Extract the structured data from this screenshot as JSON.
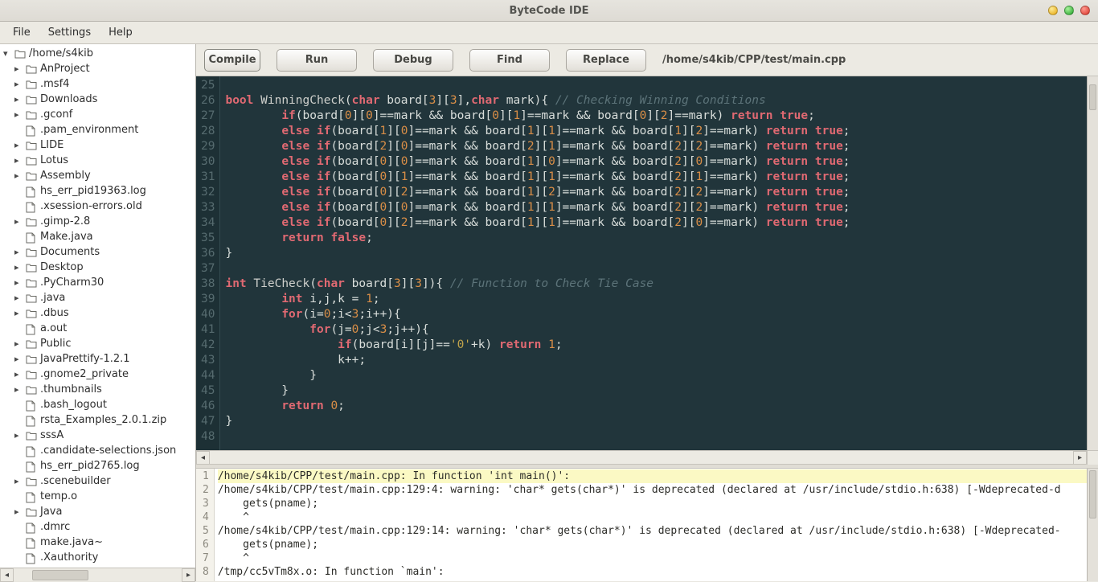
{
  "window": {
    "title": "ByteCode IDE"
  },
  "menu": {
    "file": "File",
    "settings": "Settings",
    "help": "Help"
  },
  "toolbar": {
    "compile": "Compile",
    "run": "Run",
    "debug": "Debug",
    "find": "Find",
    "replace": "Replace",
    "path": "/home/s4kib/CPP/test/main.cpp"
  },
  "tree": {
    "root": "/home/s4kib",
    "items": [
      {
        "type": "folder",
        "name": "AnProject"
      },
      {
        "type": "folder",
        "name": ".msf4"
      },
      {
        "type": "folder",
        "name": "Downloads"
      },
      {
        "type": "folder",
        "name": ".gconf"
      },
      {
        "type": "file",
        "name": ".pam_environment"
      },
      {
        "type": "folder",
        "name": "LIDE"
      },
      {
        "type": "folder",
        "name": "Lotus"
      },
      {
        "type": "folder",
        "name": "Assembly"
      },
      {
        "type": "file",
        "name": "hs_err_pid19363.log"
      },
      {
        "type": "file",
        "name": ".xsession-errors.old"
      },
      {
        "type": "folder",
        "name": ".gimp-2.8"
      },
      {
        "type": "file",
        "name": "Make.java"
      },
      {
        "type": "folder",
        "name": "Documents"
      },
      {
        "type": "folder",
        "name": "Desktop"
      },
      {
        "type": "folder",
        "name": ".PyCharm30"
      },
      {
        "type": "folder",
        "name": ".java"
      },
      {
        "type": "folder",
        "name": ".dbus"
      },
      {
        "type": "file",
        "name": "a.out"
      },
      {
        "type": "folder",
        "name": "Public"
      },
      {
        "type": "folder",
        "name": "JavaPrettify-1.2.1"
      },
      {
        "type": "folder",
        "name": ".gnome2_private"
      },
      {
        "type": "folder",
        "name": ".thumbnails"
      },
      {
        "type": "file",
        "name": ".bash_logout"
      },
      {
        "type": "file",
        "name": "rsta_Examples_2.0.1.zip"
      },
      {
        "type": "folder",
        "name": "sssA"
      },
      {
        "type": "file",
        "name": ".candidate-selections.json"
      },
      {
        "type": "file",
        "name": "hs_err_pid2765.log"
      },
      {
        "type": "folder",
        "name": ".scenebuilder"
      },
      {
        "type": "file",
        "name": "temp.o"
      },
      {
        "type": "folder",
        "name": "Java"
      },
      {
        "type": "file",
        "name": ".dmrc"
      },
      {
        "type": "file",
        "name": "make.java~"
      },
      {
        "type": "file",
        "name": ".Xauthority"
      }
    ]
  },
  "editor": {
    "first_line": 25,
    "lines": [
      {
        "n": 25,
        "seg": [
          [
            "",
            ""
          ]
        ]
      },
      {
        "n": 26,
        "seg": [
          [
            "kw",
            "bool"
          ],
          [
            "",
            " "
          ],
          [
            "fn",
            "WinningCheck"
          ],
          [
            "",
            "("
          ],
          [
            "type",
            "char"
          ],
          [
            "",
            " board["
          ],
          [
            "num",
            "3"
          ],
          [
            "",
            "]["
          ],
          [
            "num",
            "3"
          ],
          [
            "",
            "],"
          ],
          [
            "type",
            "char"
          ],
          [
            "",
            " mark){ "
          ],
          [
            "cmt",
            "// Checking Winning Conditions"
          ]
        ]
      },
      {
        "n": 27,
        "seg": [
          [
            "",
            "        "
          ],
          [
            "kw",
            "if"
          ],
          [
            "",
            "(board["
          ],
          [
            "num",
            "0"
          ],
          [
            "",
            "]["
          ],
          [
            "num",
            "0"
          ],
          [
            "",
            "]==mark && board["
          ],
          [
            "num",
            "0"
          ],
          [
            "",
            "]["
          ],
          [
            "num",
            "1"
          ],
          [
            "",
            "]==mark && board["
          ],
          [
            "num",
            "0"
          ],
          [
            "",
            "]["
          ],
          [
            "num",
            "2"
          ],
          [
            "",
            "]==mark) "
          ],
          [
            "kw",
            "return"
          ],
          [
            "",
            " "
          ],
          [
            "kw",
            "true"
          ],
          [
            "",
            ";"
          ]
        ]
      },
      {
        "n": 28,
        "seg": [
          [
            "",
            "        "
          ],
          [
            "kw",
            "else"
          ],
          [
            "",
            " "
          ],
          [
            "kw",
            "if"
          ],
          [
            "",
            "(board["
          ],
          [
            "num",
            "1"
          ],
          [
            "",
            "]["
          ],
          [
            "num",
            "0"
          ],
          [
            "",
            "]==mark && board["
          ],
          [
            "num",
            "1"
          ],
          [
            "",
            "]["
          ],
          [
            "num",
            "1"
          ],
          [
            "",
            "]==mark && board["
          ],
          [
            "num",
            "1"
          ],
          [
            "",
            "]["
          ],
          [
            "num",
            "2"
          ],
          [
            "",
            "]==mark) "
          ],
          [
            "kw",
            "return"
          ],
          [
            "",
            " "
          ],
          [
            "kw",
            "true"
          ],
          [
            "",
            ";"
          ]
        ]
      },
      {
        "n": 29,
        "seg": [
          [
            "",
            "        "
          ],
          [
            "kw",
            "else"
          ],
          [
            "",
            " "
          ],
          [
            "kw",
            "if"
          ],
          [
            "",
            "(board["
          ],
          [
            "num",
            "2"
          ],
          [
            "",
            "]["
          ],
          [
            "num",
            "0"
          ],
          [
            "",
            "]==mark && board["
          ],
          [
            "num",
            "2"
          ],
          [
            "",
            "]["
          ],
          [
            "num",
            "1"
          ],
          [
            "",
            "]==mark && board["
          ],
          [
            "num",
            "2"
          ],
          [
            "",
            "]["
          ],
          [
            "num",
            "2"
          ],
          [
            "",
            "]==mark) "
          ],
          [
            "kw",
            "return"
          ],
          [
            "",
            " "
          ],
          [
            "kw",
            "true"
          ],
          [
            "",
            ";"
          ]
        ]
      },
      {
        "n": 30,
        "seg": [
          [
            "",
            "        "
          ],
          [
            "kw",
            "else"
          ],
          [
            "",
            " "
          ],
          [
            "kw",
            "if"
          ],
          [
            "",
            "(board["
          ],
          [
            "num",
            "0"
          ],
          [
            "",
            "]["
          ],
          [
            "num",
            "0"
          ],
          [
            "",
            "]==mark && board["
          ],
          [
            "num",
            "1"
          ],
          [
            "",
            "]["
          ],
          [
            "num",
            "0"
          ],
          [
            "",
            "]==mark && board["
          ],
          [
            "num",
            "2"
          ],
          [
            "",
            "]["
          ],
          [
            "num",
            "0"
          ],
          [
            "",
            "]==mark) "
          ],
          [
            "kw",
            "return"
          ],
          [
            "",
            " "
          ],
          [
            "kw",
            "true"
          ],
          [
            "",
            ";"
          ]
        ]
      },
      {
        "n": 31,
        "seg": [
          [
            "",
            "        "
          ],
          [
            "kw",
            "else"
          ],
          [
            "",
            " "
          ],
          [
            "kw",
            "if"
          ],
          [
            "",
            "(board["
          ],
          [
            "num",
            "0"
          ],
          [
            "",
            "]["
          ],
          [
            "num",
            "1"
          ],
          [
            "",
            "]==mark && board["
          ],
          [
            "num",
            "1"
          ],
          [
            "",
            "]["
          ],
          [
            "num",
            "1"
          ],
          [
            "",
            "]==mark && board["
          ],
          [
            "num",
            "2"
          ],
          [
            "",
            "]["
          ],
          [
            "num",
            "1"
          ],
          [
            "",
            "]==mark) "
          ],
          [
            "kw",
            "return"
          ],
          [
            "",
            " "
          ],
          [
            "kw",
            "true"
          ],
          [
            "",
            ";"
          ]
        ]
      },
      {
        "n": 32,
        "seg": [
          [
            "",
            "        "
          ],
          [
            "kw",
            "else"
          ],
          [
            "",
            " "
          ],
          [
            "kw",
            "if"
          ],
          [
            "",
            "(board["
          ],
          [
            "num",
            "0"
          ],
          [
            "",
            "]["
          ],
          [
            "num",
            "2"
          ],
          [
            "",
            "]==mark && board["
          ],
          [
            "num",
            "1"
          ],
          [
            "",
            "]["
          ],
          [
            "num",
            "2"
          ],
          [
            "",
            "]==mark && board["
          ],
          [
            "num",
            "2"
          ],
          [
            "",
            "]["
          ],
          [
            "num",
            "2"
          ],
          [
            "",
            "]==mark) "
          ],
          [
            "kw",
            "return"
          ],
          [
            "",
            " "
          ],
          [
            "kw",
            "true"
          ],
          [
            "",
            ";"
          ]
        ]
      },
      {
        "n": 33,
        "seg": [
          [
            "",
            "        "
          ],
          [
            "kw",
            "else"
          ],
          [
            "",
            " "
          ],
          [
            "kw",
            "if"
          ],
          [
            "",
            "(board["
          ],
          [
            "num",
            "0"
          ],
          [
            "",
            "]["
          ],
          [
            "num",
            "0"
          ],
          [
            "",
            "]==mark && board["
          ],
          [
            "num",
            "1"
          ],
          [
            "",
            "]["
          ],
          [
            "num",
            "1"
          ],
          [
            "",
            "]==mark && board["
          ],
          [
            "num",
            "2"
          ],
          [
            "",
            "]["
          ],
          [
            "num",
            "2"
          ],
          [
            "",
            "]==mark) "
          ],
          [
            "kw",
            "return"
          ],
          [
            "",
            " "
          ],
          [
            "kw",
            "true"
          ],
          [
            "",
            ";"
          ]
        ]
      },
      {
        "n": 34,
        "seg": [
          [
            "",
            "        "
          ],
          [
            "kw",
            "else"
          ],
          [
            "",
            " "
          ],
          [
            "kw",
            "if"
          ],
          [
            "",
            "(board["
          ],
          [
            "num",
            "0"
          ],
          [
            "",
            "]["
          ],
          [
            "num",
            "2"
          ],
          [
            "",
            "]==mark && board["
          ],
          [
            "num",
            "1"
          ],
          [
            "",
            "]["
          ],
          [
            "num",
            "1"
          ],
          [
            "",
            "]==mark && board["
          ],
          [
            "num",
            "2"
          ],
          [
            "",
            "]["
          ],
          [
            "num",
            "0"
          ],
          [
            "",
            "]==mark) "
          ],
          [
            "kw",
            "return"
          ],
          [
            "",
            " "
          ],
          [
            "kw",
            "true"
          ],
          [
            "",
            ";"
          ]
        ]
      },
      {
        "n": 35,
        "seg": [
          [
            "",
            "        "
          ],
          [
            "kw",
            "return"
          ],
          [
            "",
            " "
          ],
          [
            "kw",
            "false"
          ],
          [
            "",
            ";"
          ]
        ]
      },
      {
        "n": 36,
        "seg": [
          [
            "",
            "}"
          ]
        ]
      },
      {
        "n": 37,
        "seg": [
          [
            "",
            ""
          ]
        ]
      },
      {
        "n": 38,
        "seg": [
          [
            "kw",
            "int"
          ],
          [
            "",
            " "
          ],
          [
            "fn",
            "TieCheck"
          ],
          [
            "",
            "("
          ],
          [
            "type",
            "char"
          ],
          [
            "",
            " board["
          ],
          [
            "num",
            "3"
          ],
          [
            "",
            "]["
          ],
          [
            "num",
            "3"
          ],
          [
            "",
            "]){ "
          ],
          [
            "cmt",
            "// Function to Check Tie Case"
          ]
        ]
      },
      {
        "n": 39,
        "seg": [
          [
            "",
            "        "
          ],
          [
            "kw",
            "int"
          ],
          [
            "",
            " i,j,k = "
          ],
          [
            "num",
            "1"
          ],
          [
            "",
            ";"
          ]
        ]
      },
      {
        "n": 40,
        "seg": [
          [
            "",
            "        "
          ],
          [
            "kw",
            "for"
          ],
          [
            "",
            "(i="
          ],
          [
            "num",
            "0"
          ],
          [
            "",
            ";i<"
          ],
          [
            "num",
            "3"
          ],
          [
            "",
            ";i++){"
          ]
        ]
      },
      {
        "n": 41,
        "seg": [
          [
            "",
            "            "
          ],
          [
            "kw",
            "for"
          ],
          [
            "",
            "(j="
          ],
          [
            "num",
            "0"
          ],
          [
            "",
            ";j<"
          ],
          [
            "num",
            "3"
          ],
          [
            "",
            ";j++){"
          ]
        ]
      },
      {
        "n": 42,
        "seg": [
          [
            "",
            "                "
          ],
          [
            "kw",
            "if"
          ],
          [
            "",
            "(board[i][j]=="
          ],
          [
            "str",
            "'0'"
          ],
          [
            "",
            "+k) "
          ],
          [
            "kw",
            "return"
          ],
          [
            "",
            " "
          ],
          [
            "num",
            "1"
          ],
          [
            "",
            ";"
          ]
        ]
      },
      {
        "n": 43,
        "seg": [
          [
            "",
            "                k++;"
          ]
        ]
      },
      {
        "n": 44,
        "seg": [
          [
            "",
            "            }"
          ]
        ]
      },
      {
        "n": 45,
        "seg": [
          [
            "",
            "        }"
          ]
        ]
      },
      {
        "n": 46,
        "seg": [
          [
            "",
            "        "
          ],
          [
            "kw",
            "return"
          ],
          [
            "",
            " "
          ],
          [
            "num",
            "0"
          ],
          [
            "",
            ";"
          ]
        ]
      },
      {
        "n": 47,
        "seg": [
          [
            "",
            "}"
          ]
        ]
      },
      {
        "n": 48,
        "seg": [
          [
            "",
            ""
          ]
        ]
      }
    ]
  },
  "console": {
    "lines": [
      {
        "n": 1,
        "hl": true,
        "text": "/home/s4kib/CPP/test/main.cpp: In function 'int main()':"
      },
      {
        "n": 2,
        "hl": false,
        "text": "/home/s4kib/CPP/test/main.cpp:129:4: warning: 'char* gets(char*)' is deprecated (declared at /usr/include/stdio.h:638) [-Wdeprecated-d"
      },
      {
        "n": 3,
        "hl": false,
        "text": "    gets(pname);"
      },
      {
        "n": 4,
        "hl": false,
        "text": "    ^"
      },
      {
        "n": 5,
        "hl": false,
        "text": "/home/s4kib/CPP/test/main.cpp:129:14: warning: 'char* gets(char*)' is deprecated (declared at /usr/include/stdio.h:638) [-Wdeprecated-"
      },
      {
        "n": 6,
        "hl": false,
        "text": "    gets(pname);"
      },
      {
        "n": 7,
        "hl": false,
        "text": "    ^"
      },
      {
        "n": 8,
        "hl": false,
        "text": "/tmp/cc5vTm8x.o: In function `main':"
      }
    ]
  }
}
